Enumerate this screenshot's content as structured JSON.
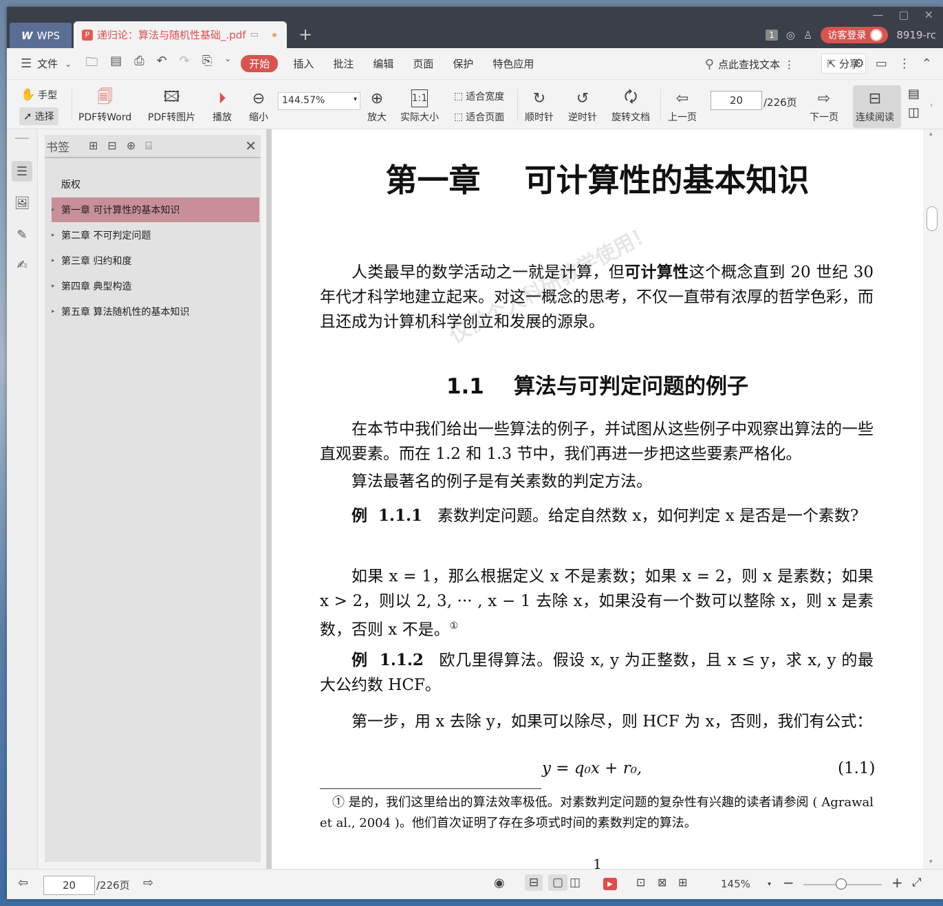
{
  "titlebar": {
    "app_tab": "WPS",
    "doc_tab": "递归论：算法与随机性基础_.pdf",
    "page_badge": "1",
    "login_label": "访客登录",
    "version": "8919-rc"
  },
  "menubar": {
    "file_label": "文件",
    "items": [
      "开始",
      "插入",
      "批注",
      "编辑",
      "页面",
      "保护",
      "特色应用"
    ],
    "search_label": "点此查找文本",
    "share_label": "分享"
  },
  "toolbar": {
    "hand": "手型",
    "select": "选择",
    "pdf_to_word": "PDF转Word",
    "pdf_to_image": "PDF转图片",
    "play": "播放",
    "zoom_out": "缩小",
    "zoom_value": "144.57%",
    "zoom_in": "放大",
    "actual_size": "实际大小",
    "fit_width": "适合宽度",
    "fit_page": "适合页面",
    "clockwise": "顺时针",
    "counter_clockwise": "逆时针",
    "rotate_doc": "旋转文档",
    "prev_page": "上一页",
    "page_input": "20",
    "page_total": "/226页",
    "next_page": "下一页",
    "continuous": "连续阅读"
  },
  "bookmarks": {
    "title": "书签",
    "items": [
      {
        "label": "版权",
        "expandable": false
      },
      {
        "label": "第一章  可计算性的基本知识",
        "expandable": true,
        "selected": true
      },
      {
        "label": "第二章  不可判定问题",
        "expandable": true
      },
      {
        "label": "第三章  归约和度",
        "expandable": true
      },
      {
        "label": "第四章  典型构造",
        "expandable": true
      },
      {
        "label": "第五章  算法随机性的基本知识",
        "expandable": true
      }
    ]
  },
  "page": {
    "chapter_title": "第一章    可计算性的基本知识",
    "watermark": "仅供个人科研教学使用！",
    "intro_pre": "人类最早的数学活动之一就是计算，但",
    "intro_bold": "可计算性",
    "intro_post": "这个概念直到 20 世纪 30 年代才科学地建立起来。对这一概念的思考，不仅一直带有浓厚的哲学色彩，而且还成为计算机科学创立和发展的源泉。",
    "section_title": "1.1    算法与可判定问题的例子",
    "para1": "在本节中我们给出一些算法的例子，并试图从这些例子中观察出算法的一些直观要素。而在 1.2 和 1.3 节中，我们再进一步把这些要素严格化。",
    "para2": "算法最著名的例子是有关素数的判定方法。",
    "ex1_label": "例  1.1.1",
    "ex1_text": "素数判定问题。给定自然数 x，如何判定 x 是否是一个素数?",
    "para3": "如果 x = 1，那么根据定义 x 不是素数；如果 x = 2，则 x 是素数；如果 x > 2，则以 2, 3, ··· , x − 1 去除 x，如果没有一个数可以整除 x，则 x 是素数，否则 x 不是。",
    "para3_fn": "①",
    "ex2_label": "例  1.1.2",
    "ex2_text": "欧几里得算法。假设 x, y 为正整数，且 x ≤ y，求 x, y 的最大公约数 HCF。",
    "para4": "第一步，用 x 去除 y，如果可以除尽，则 HCF 为 x，否则，我们有公式：",
    "equation": "y = q₀x + r₀,",
    "eq_number": "(1.1)",
    "footnote_mark": "①",
    "footnote": "是的，我们这里给出的算法效率极低。对素数判定问题的复杂性有兴趣的读者请参阅 ( Agrawal et al., 2004 )。他们首次证明了存在多项式时间的素数判定的算法。",
    "page_number": "1"
  },
  "statusbar": {
    "page_input": "20",
    "page_total": "/226页",
    "zoom": "145%"
  }
}
